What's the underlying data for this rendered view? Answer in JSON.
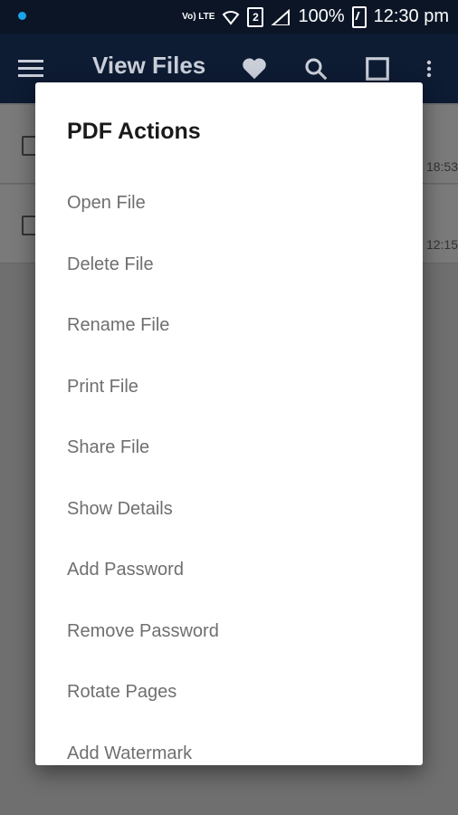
{
  "status_bar": {
    "volte": "Vo) LTE",
    "sim_slot": "2",
    "battery_percent": "100%",
    "time": "12:30 pm"
  },
  "app_bar": {
    "title": "View Files",
    "icons": [
      "hamburger-menu-icon",
      "heart-icon",
      "search-icon",
      "select-all-square-icon",
      "more-vert-icon"
    ]
  },
  "background_list": {
    "items": [
      {
        "time": "18:53"
      },
      {
        "time": "12:15"
      }
    ]
  },
  "dialog": {
    "title": "PDF Actions",
    "items": [
      {
        "label": "Open File"
      },
      {
        "label": "Delete File"
      },
      {
        "label": "Rename File"
      },
      {
        "label": "Print File"
      },
      {
        "label": "Share File"
      },
      {
        "label": "Show Details"
      },
      {
        "label": "Add Password"
      },
      {
        "label": "Remove Password"
      },
      {
        "label": "Rotate Pages"
      },
      {
        "label": "Add Watermark"
      }
    ]
  },
  "colors": {
    "app_bar": "#0d1b33",
    "status_bar": "#0b1526",
    "scrim": "#6f6f6f",
    "dialog_bg": "#ffffff",
    "item_text": "#6f6f6f"
  }
}
